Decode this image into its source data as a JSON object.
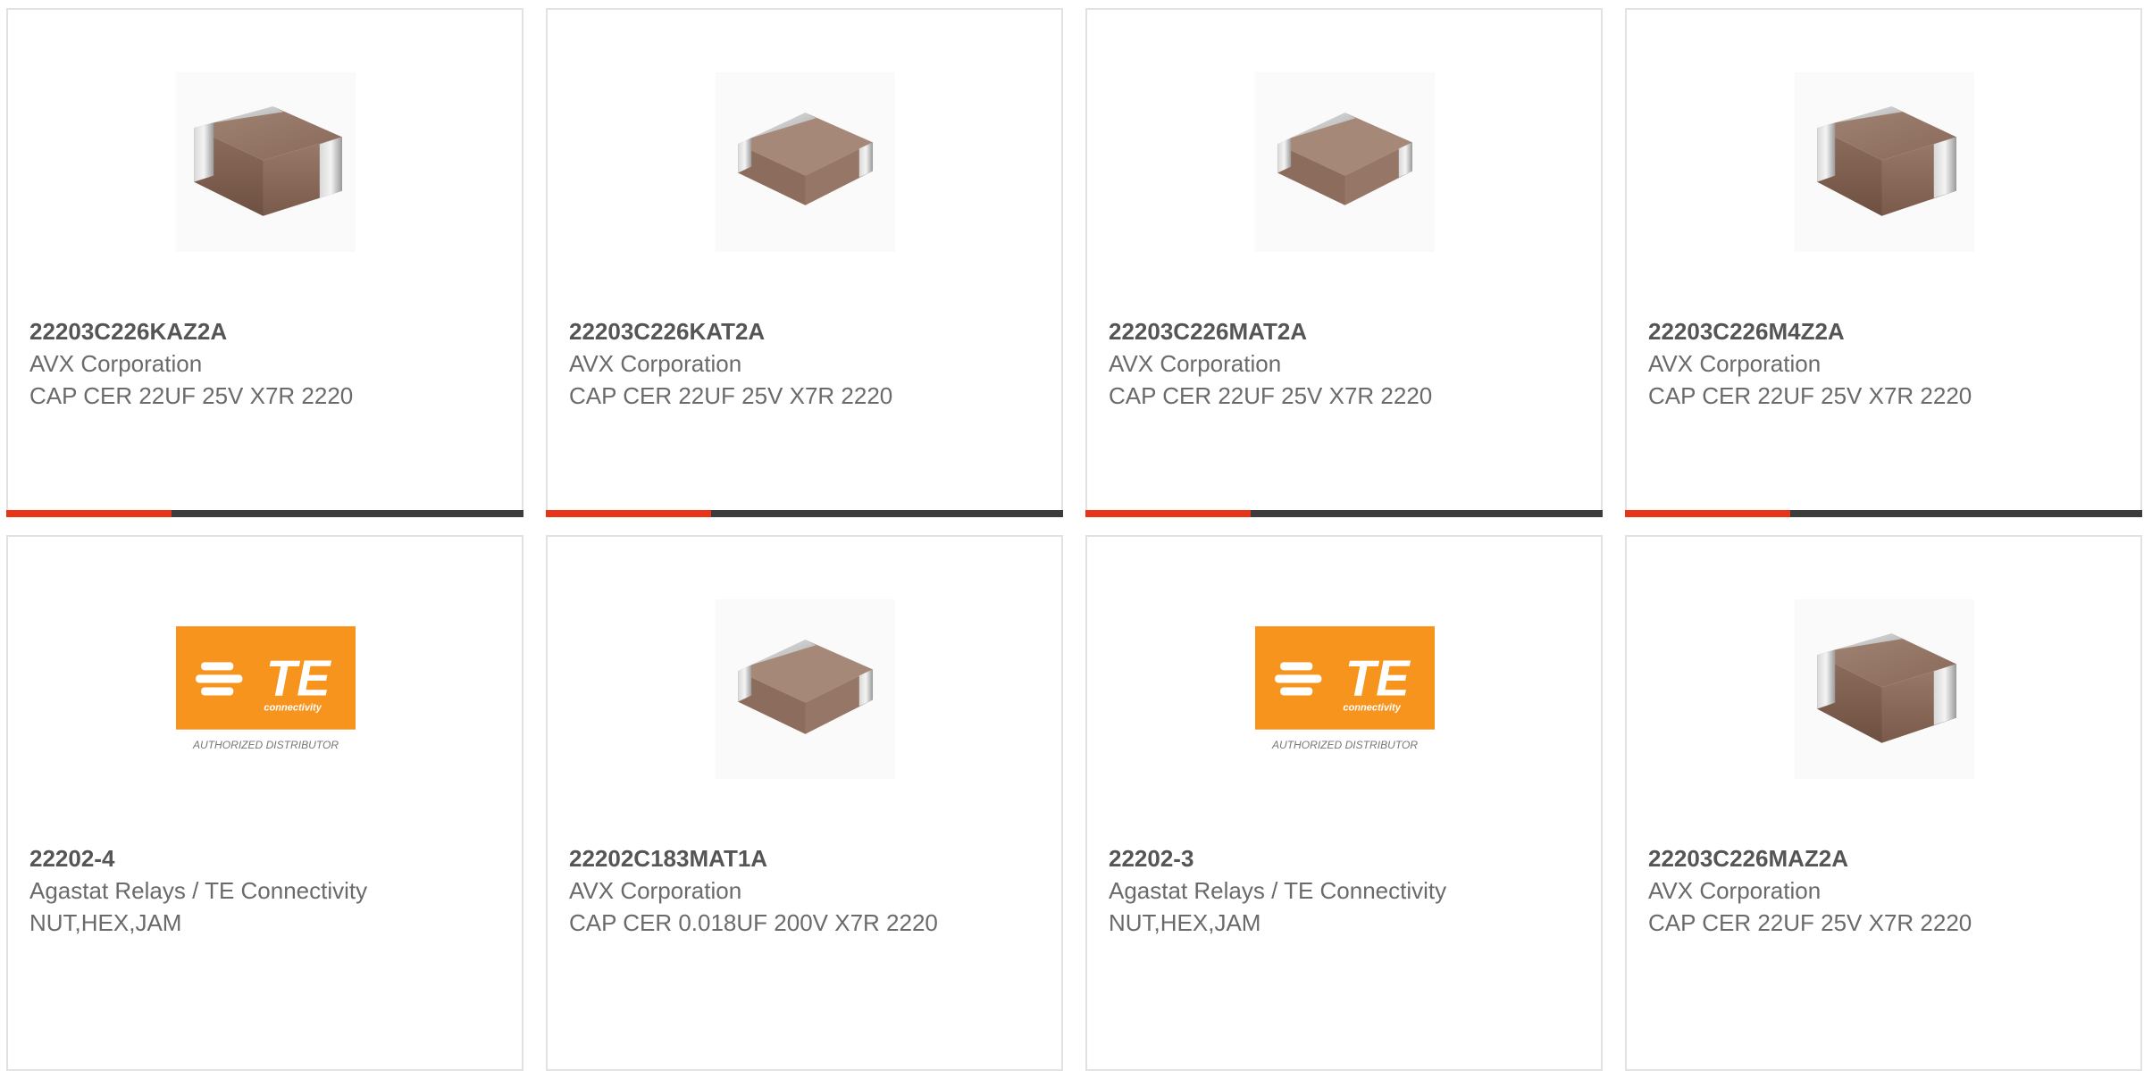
{
  "products": [
    {
      "part": "22203C226KAZ2A",
      "manufacturer": "AVX Corporation",
      "description": "CAP CER 22UF 25V X7R 2220",
      "image": "capacitor-icon"
    },
    {
      "part": "22203C226KAT2A",
      "manufacturer": "AVX Corporation",
      "description": "CAP CER 22UF 25V X7R 2220",
      "image": "capacitor-icon"
    },
    {
      "part": "22203C226MAT2A",
      "manufacturer": "AVX Corporation",
      "description": "CAP CER 22UF 25V X7R 2220",
      "image": "capacitor-icon"
    },
    {
      "part": "22203C226M4Z2A",
      "manufacturer": "AVX Corporation",
      "description": "CAP CER 22UF 25V X7R 2220",
      "image": "capacitor-icon"
    },
    {
      "part": "22202-4",
      "manufacturer": "Agastat Relays / TE Connectivity",
      "description": "NUT,HEX,JAM",
      "image": "te-logo"
    },
    {
      "part": "22202C183MAT1A",
      "manufacturer": "AVX Corporation",
      "description": "CAP CER 0.018UF 200V X7R 2220",
      "image": "capacitor-icon"
    },
    {
      "part": "22202-3",
      "manufacturer": "Agastat Relays / TE Connectivity",
      "description": "NUT,HEX,JAM",
      "image": "te-logo"
    },
    {
      "part": "22203C226MAZ2A",
      "manufacturer": "AVX Corporation",
      "description": "CAP CER 22UF 25V X7R 2220",
      "image": "capacitor-icon"
    }
  ],
  "te_logo": {
    "text": "TE",
    "subtext": "connectivity",
    "caption": "AUTHORIZED DISTRIBUTOR"
  },
  "progress_fraction": 0.32,
  "colors": {
    "accent": "#e8351a",
    "bar": "#3c3c3c",
    "te_orange": "#f7941d",
    "text_bold": "#555555",
    "text": "#6a6a6a"
  }
}
